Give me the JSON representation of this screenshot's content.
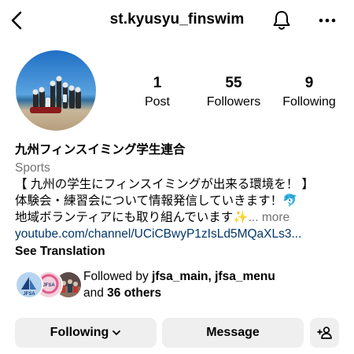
{
  "header": {
    "username": "st.kyusyu_finswim",
    "back_icon": "chevron-left-icon",
    "notification_icon": "bell-icon",
    "more_icon": "more-horizontal-icon"
  },
  "stats": {
    "posts": {
      "count": "1",
      "label": "Post"
    },
    "followers": {
      "count": "55",
      "label": "Followers"
    },
    "following": {
      "count": "9",
      "label": "Following"
    }
  },
  "bio": {
    "name": "九州フィンスイミング学生連合",
    "category": "Sports",
    "line1": "【 九州の学生にフィンスイミングが出来る環境を！ 】",
    "line2": "体験会・練習会について情報発信していきます！🐬",
    "line3": "地域ボランティアにも取り組んでいます✨",
    "more": "... more",
    "link": "youtube.com/channel/UCiCBwyP1zIsLd5MQaXLs3...",
    "see_translation": "See Translation"
  },
  "followed_by": {
    "prefix": "Followed by ",
    "accounts": "jfsa_main, jfsa_menu",
    "and": "and ",
    "others": "36 others",
    "avatar_label": "JFSA"
  },
  "actions": {
    "following_label": "Following",
    "message_label": "Message",
    "add_person_icon": "add-person-icon"
  },
  "colors": {
    "link": "#00376b",
    "secondary_text": "#737373",
    "button_bg": "#efefef"
  }
}
